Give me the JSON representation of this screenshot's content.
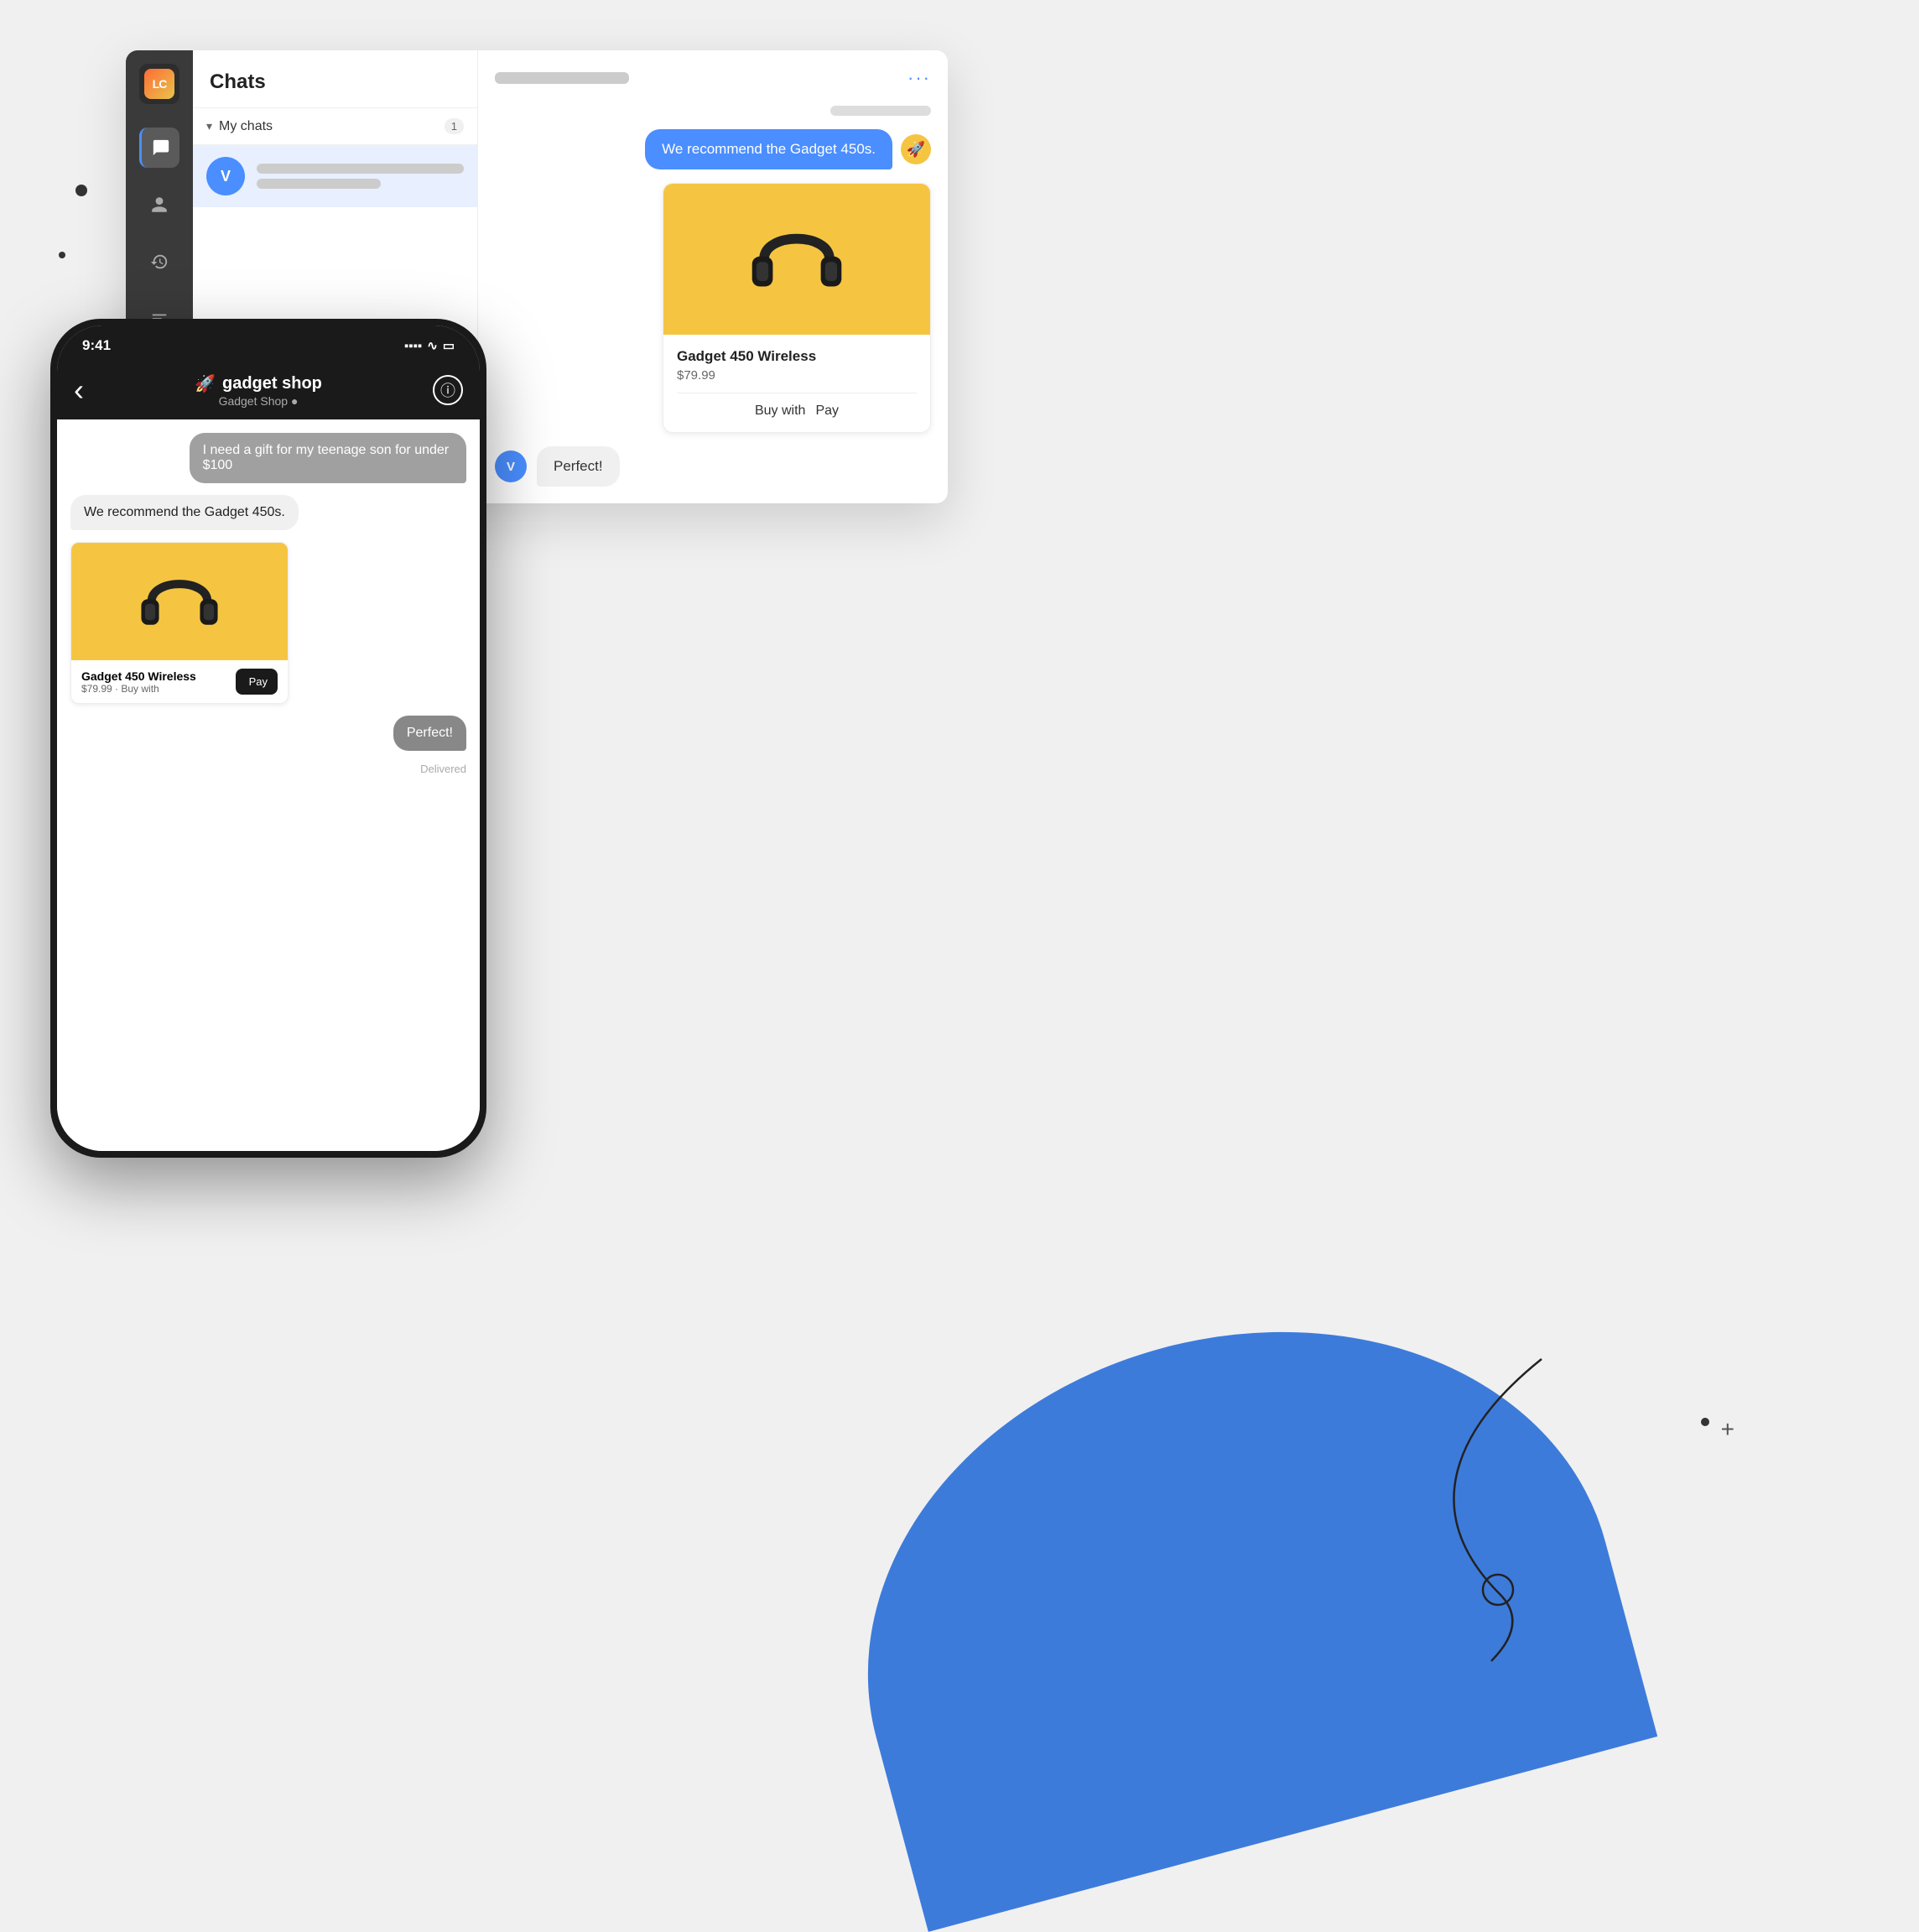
{
  "app": {
    "logo_text": "LC",
    "title": "Chats"
  },
  "sidebar": {
    "items": [
      {
        "id": "chat",
        "icon": "chat-icon",
        "active": true
      },
      {
        "id": "contacts",
        "icon": "contacts-icon",
        "active": false
      },
      {
        "id": "history",
        "icon": "history-icon",
        "active": false
      },
      {
        "id": "reports",
        "icon": "reports-icon",
        "active": false
      },
      {
        "id": "team",
        "icon": "team-icon",
        "active": false
      }
    ]
  },
  "chats_panel": {
    "header": "Chats",
    "my_chats_label": "My chats",
    "chat_count": "1",
    "chat_item": {
      "avatar_letter": "V"
    }
  },
  "chat_area": {
    "three_dots": "···",
    "message_out": "We recommend the Gadget 450s.",
    "product": {
      "name": "Gadget 450 Wireless",
      "price": "$79.99",
      "buy_label": "Buy with",
      "pay_label": "Pay"
    },
    "message_in": "Perfect!",
    "in_avatar_letter": "V"
  },
  "phone": {
    "time": "9:41",
    "signal_icons": "▲ ▲ ▲ ▲ ◀ □",
    "back_arrow": "‹",
    "shop_name": "gadget shop",
    "shop_status": "Gadget Shop ●",
    "info_icon": "ⓘ",
    "messages": [
      {
        "type": "user",
        "text": "I need a gift for my teenage son for under $100"
      },
      {
        "type": "agent",
        "text": "We recommend the Gadget 450s."
      }
    ],
    "product": {
      "name": "Gadget 450 Wireless",
      "price_label": "$79.99 · Buy with",
      "pay_label": "Pay"
    },
    "reply_text": "Perfect!",
    "delivered_label": "Delivered"
  },
  "decorative": {
    "dots": [
      "dot-1",
      "dot-2",
      "dot-3",
      "dot-4"
    ],
    "plus": "+"
  }
}
